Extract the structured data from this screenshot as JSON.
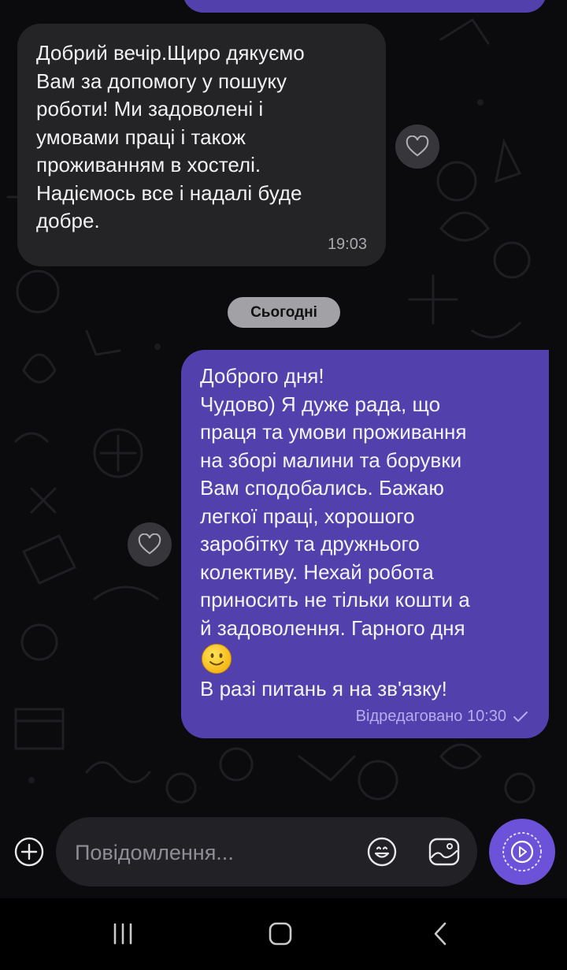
{
  "chat": {
    "messages": [
      {
        "direction": "incoming",
        "text": "Добрий вечір.Щиро дякуємо\nВам за допомогу у пошуку\nроботи! Ми задоволені і\nумовами праці і також\nпроживанням в хостелі.\nНадіємось все і надалі буде\nдобре.",
        "time": "19:03"
      },
      {
        "direction": "outgoing",
        "text": "Доброго дня!\nЧудово) Я дуже рада, що\nпраця та умови проживання\nна зборі малини та борувки\nВам сподобались. Бажаю\nлегкої праці, хорошого\nзаробітку та дружнього\nколективу. Нехай робота\nприносить не тільки кошти а\nй задоволення. Гарного дня",
        "emoji": "slightly-smiling-face",
        "text_after_emoji": "В разі питань я на зв'язку!",
        "status": "Відредаговано 10:30",
        "status_icon": "check-icon"
      }
    ],
    "date_separator": "Сьогодні"
  },
  "composer": {
    "placeholder": "Повідомлення...",
    "value": ""
  },
  "colors": {
    "background": "#0b0b0d",
    "incoming_bubble": "#242427",
    "outgoing_bubble": "#5240ad",
    "send_button": "#6c52d8"
  },
  "icons": {
    "reaction": "heart-outline-icon",
    "attach": "plus-circle-icon",
    "emoji": "smiley-icon",
    "gallery": "image-icon",
    "send": "send-play-icon",
    "nav": [
      "recent-apps-icon",
      "home-icon",
      "back-icon"
    ]
  }
}
